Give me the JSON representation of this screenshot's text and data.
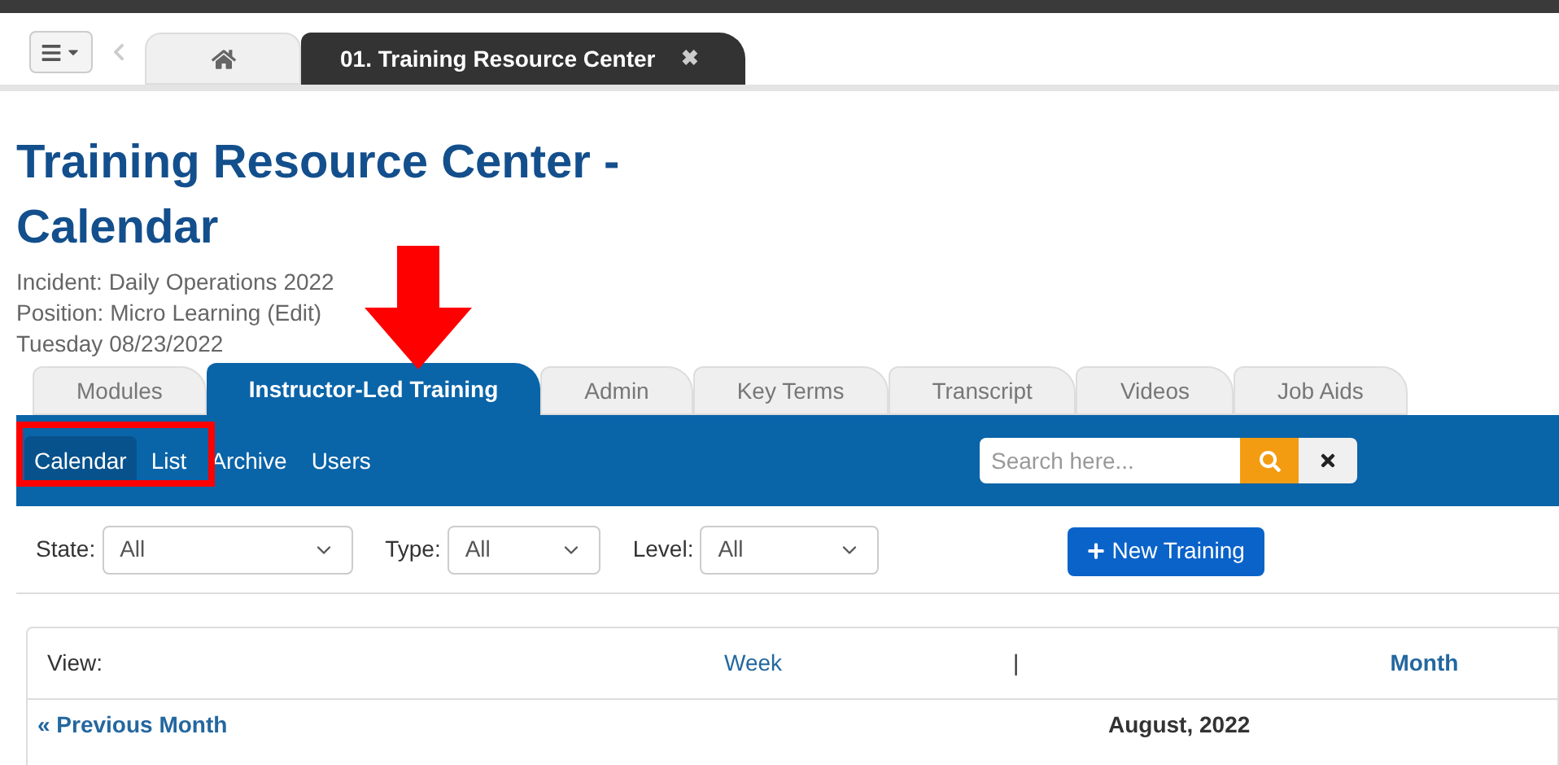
{
  "top_tabs": [
    {
      "kind": "home",
      "selected": false
    },
    {
      "kind": "text",
      "label": "01. Training Resource Center",
      "selected": true,
      "close": "✖"
    }
  ],
  "title": "Training Resource Center - Calendar",
  "info": [
    "Incident: Daily Operations 2022",
    "Position: Micro Learning (Edit)",
    "Tuesday 08/23/2022"
  ],
  "tabs": [
    {
      "label": "Modules",
      "selected": false
    },
    {
      "label": "Instructor-Led Training",
      "selected": true
    },
    {
      "label": "Admin",
      "selected": false
    },
    {
      "label": "Key Terms",
      "selected": false
    },
    {
      "label": "Transcript",
      "selected": false
    },
    {
      "label": "Videos",
      "selected": false
    },
    {
      "label": "Job Aids",
      "selected": false
    }
  ],
  "subnav": [
    {
      "label": "Calendar",
      "selected": true
    },
    {
      "label": "List",
      "selected": false
    },
    {
      "label": "Archive",
      "selected": false
    },
    {
      "label": "Users",
      "selected": false
    }
  ],
  "search": {
    "placeholder": "Search here..."
  },
  "filters": [
    {
      "label": "State:",
      "value": "All"
    },
    {
      "label": "Type:",
      "value": "All"
    },
    {
      "label": "Level:",
      "value": "All"
    }
  ],
  "new_button": "New Training",
  "view": {
    "label": "View:",
    "options": [
      {
        "label": "Week",
        "selected": false
      },
      {
        "label": "Month",
        "selected": true
      }
    ],
    "separator": "|"
  },
  "prev_link": "« Previous Month",
  "month": "August, 2022"
}
